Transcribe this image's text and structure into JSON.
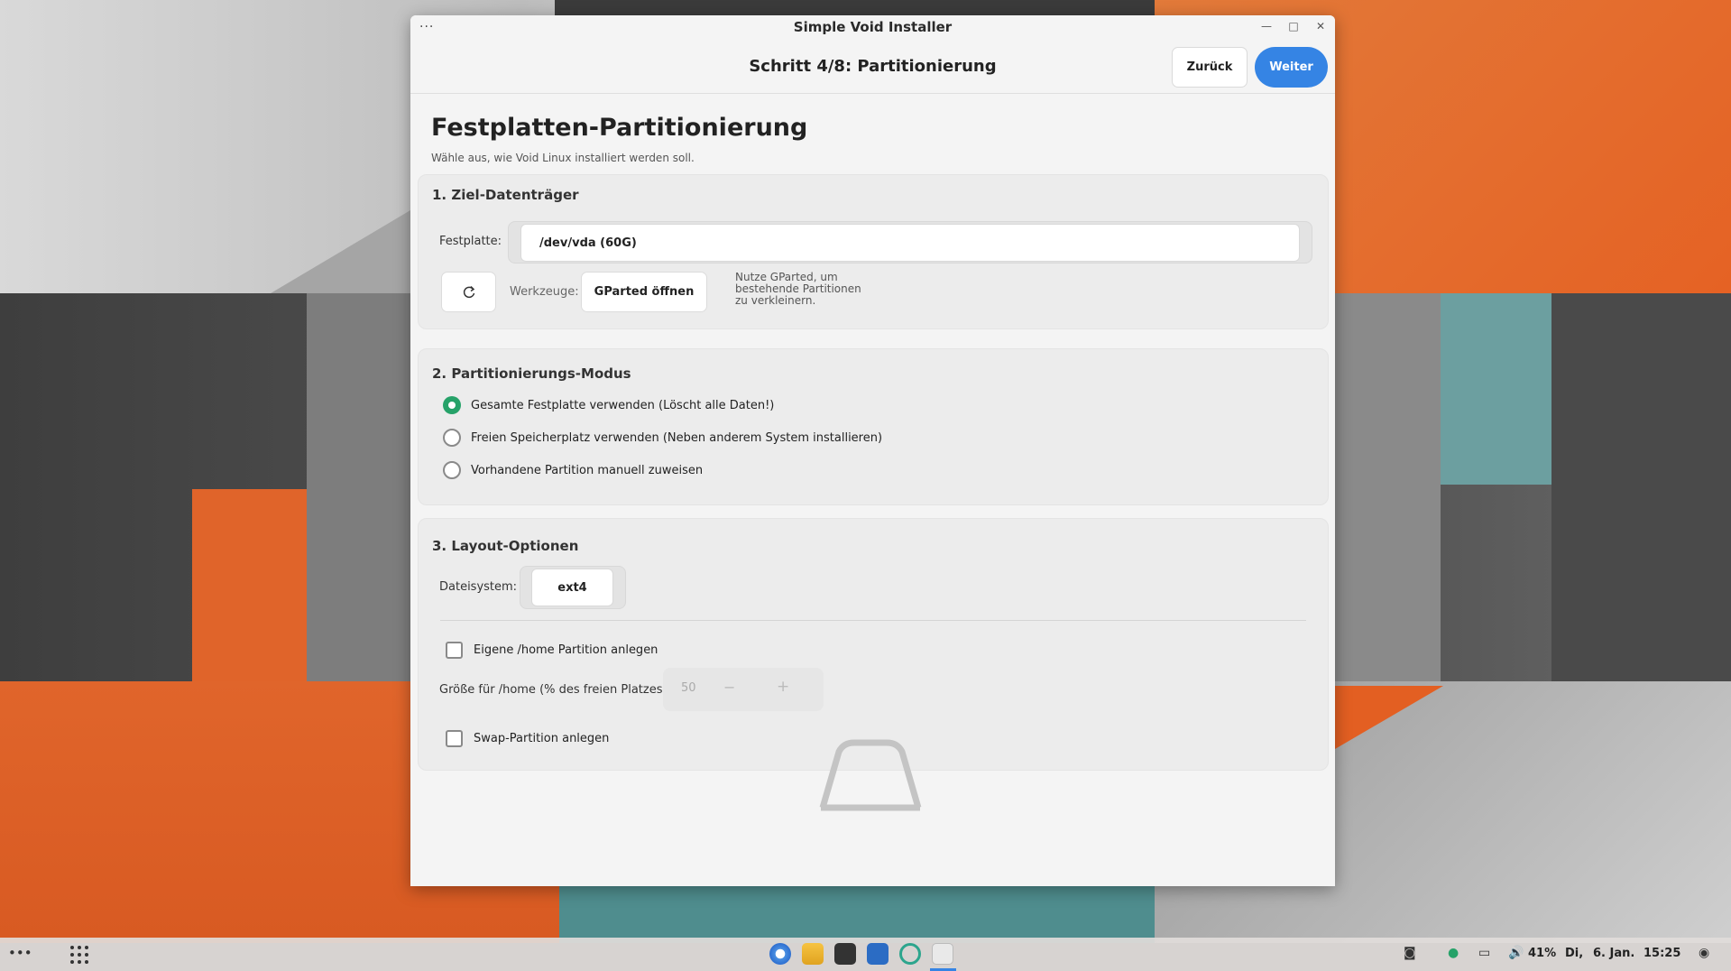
{
  "window": {
    "title": "Simple Void Installer",
    "menu_icon": "ellipsis-icon",
    "controls": [
      "minimize-icon",
      "maximize-icon",
      "close-icon"
    ]
  },
  "header": {
    "step": "Schritt 4/8: Partitionierung",
    "back_label": "Zurück",
    "next_label": "Weiter",
    "next_color": "#3584e4"
  },
  "page": {
    "title": "Festplatten-Partitionierung",
    "subtitle": "Wähle aus, wie Void Linux installiert werden soll."
  },
  "target": {
    "title": "1. Ziel-Datenträger",
    "disk_label": "Festplatte:",
    "disk_value": "/dev/vda (60G)",
    "refresh_icon": "refresh-icon",
    "tools_label": "Werkzeuge:",
    "gparted_label": "GParted öffnen",
    "hint_lines": [
      "Nutze GParted, um",
      "bestehende Partitionen",
      "zu verkleinern."
    ]
  },
  "mode": {
    "title": "2. Partitionierungs-Modus",
    "options": [
      {
        "label": "Gesamte Festplatte verwenden (Löscht alle Daten!)",
        "selected": true
      },
      {
        "label": "Freien Speicherplatz verwenden (Neben anderem System installieren)",
        "selected": false
      },
      {
        "label": "Vorhandene Partition manuell zuweisen",
        "selected": false
      }
    ],
    "selected_color": "#26a269"
  },
  "layout": {
    "title": "3. Layout-Optionen",
    "fs_label": "Dateisystem:",
    "fs_value": "ext4",
    "home_check_label": "Eigene /home Partition anlegen",
    "home_checked": false,
    "home_size_label": "Größe für /home (% des freien Platzes):",
    "home_size_value": "50",
    "home_size_minus": "−",
    "home_size_plus": "+",
    "swap_check_label": "Swap-Partition anlegen",
    "swap_checked": false
  },
  "taskbar": {
    "left_icons": [
      "overflow-icon",
      "app-grid-icon"
    ],
    "apps": [
      "chromium-icon",
      "files-icon",
      "terminal-icon",
      "vscode-icon",
      "browser-e-icon",
      "installer-icon"
    ],
    "tray": {
      "battery": "41%",
      "datetime_day": "Di,",
      "datetime_date": "6. Jan.",
      "datetime_time": "15:25",
      "icons": [
        "screenshot-icon",
        "status-green-icon",
        "network-icon",
        "volume-icon",
        "user-icon"
      ]
    }
  }
}
